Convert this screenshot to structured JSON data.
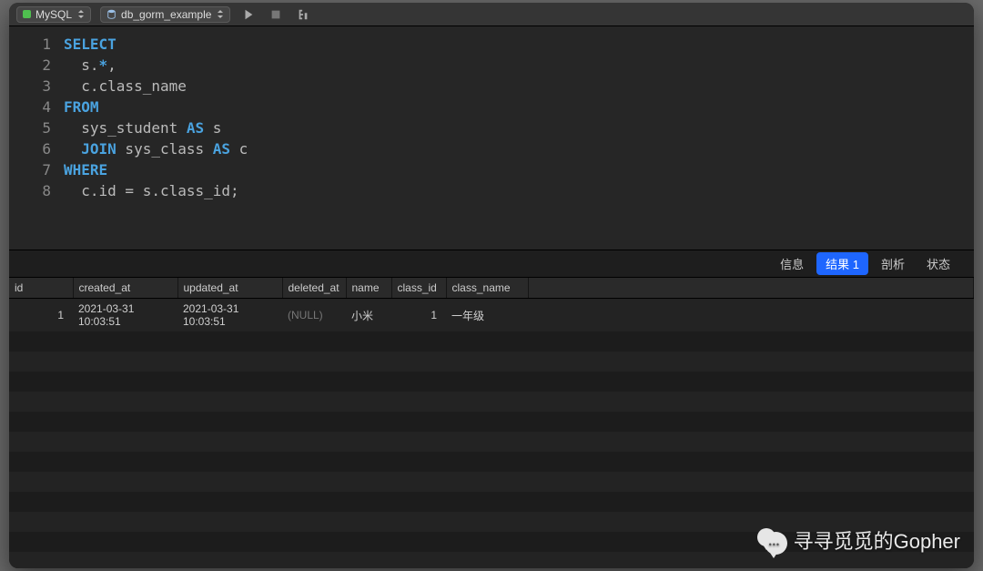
{
  "toolbar": {
    "driver": "MySQL",
    "database": "db_gorm_example"
  },
  "sql_lines": [
    [
      {
        "t": "kw",
        "v": "SELECT"
      }
    ],
    [
      {
        "t": "op",
        "v": "  s."
      },
      {
        "t": "kw",
        "v": "*"
      },
      {
        "t": "op",
        "v": ","
      }
    ],
    [
      {
        "t": "op",
        "v": "  c.class_name"
      }
    ],
    [
      {
        "t": "kw",
        "v": "FROM"
      }
    ],
    [
      {
        "t": "op",
        "v": "  sys_student "
      },
      {
        "t": "kw",
        "v": "AS"
      },
      {
        "t": "op",
        "v": " s"
      }
    ],
    [
      {
        "t": "op",
        "v": "  "
      },
      {
        "t": "kw",
        "v": "JOIN"
      },
      {
        "t": "op",
        "v": " sys_class "
      },
      {
        "t": "kw",
        "v": "AS"
      },
      {
        "t": "op",
        "v": " c"
      }
    ],
    [
      {
        "t": "kw",
        "v": "WHERE"
      }
    ],
    [
      {
        "t": "op",
        "v": "  c.id = s.class_id;"
      }
    ]
  ],
  "tabs": {
    "info": "信息",
    "result": "结果 1",
    "profile": "剖析",
    "status": "状态"
  },
  "columns": [
    "id",
    "created_at",
    "updated_at",
    "deleted_at",
    "name",
    "class_id",
    "class_name"
  ],
  "rows": [
    {
      "id": "1",
      "created_at": "2021-03-31 10:03:51",
      "updated_at": "2021-03-31 10:03:51",
      "deleted_at": "(NULL)",
      "name": "小米",
      "class_id": "1",
      "class_name": "一年级"
    }
  ],
  "watermark": "寻寻觅觅的Gopher"
}
